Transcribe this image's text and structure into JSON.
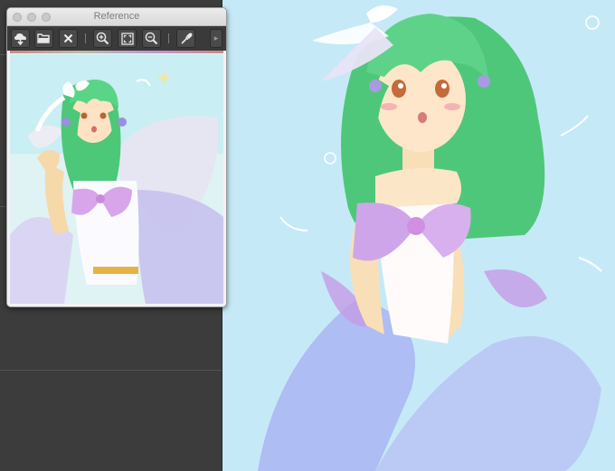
{
  "palette": {
    "title": "Reference",
    "toolbar_buttons": [
      {
        "name": "load-image-icon"
      },
      {
        "name": "open-folder-icon"
      },
      {
        "name": "close-icon"
      },
      {
        "name": "zoom-in-icon"
      },
      {
        "name": "fit-to-window-icon"
      },
      {
        "name": "zoom-out-icon"
      },
      {
        "name": "eyedropper-icon"
      }
    ],
    "more_label": "▸"
  },
  "colors": {
    "workspace": "#3c3c3c",
    "canvas_background": "#c6e9f7",
    "hair": "#55c97a",
    "skin": "#fbe6c8",
    "bow": "#d9a9e8",
    "wings": "#b7b9ef"
  }
}
